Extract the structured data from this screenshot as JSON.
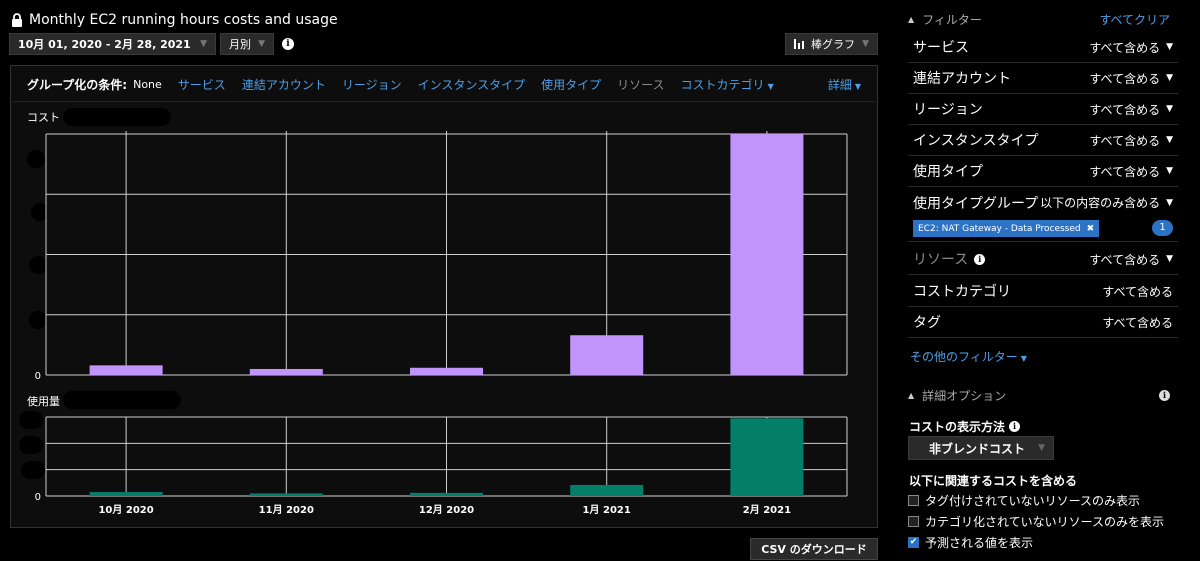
{
  "header": {
    "title": "Monthly EC2 running hours costs and usage",
    "date_range": "10月 01, 2020 - 2月 28, 2021",
    "granularity": "月別",
    "chart_type": "棒グラフ"
  },
  "group_by": {
    "label": "グループ化の条件:",
    "value": "None",
    "links": [
      "サービス",
      "連結アカウント",
      "リージョン",
      "インスタンスタイプ",
      "使用タイプ",
      "リソース",
      "コストカテゴリ"
    ],
    "detail": "詳細"
  },
  "chart_data": [
    {
      "type": "bar",
      "ylabel": "コスト",
      "categories": [
        "10月 2020",
        "11月 2020",
        "12月 2020",
        "1月 2021",
        "2月 2021"
      ],
      "values": [
        4,
        2.5,
        3,
        16.5,
        111
      ],
      "ylim": [
        0,
        100
      ],
      "y_zero_label": "0",
      "color": "#c194fb",
      "grid": true
    },
    {
      "type": "bar",
      "ylabel": "使用量",
      "categories": [
        "10月 2020",
        "11月 2020",
        "12月 2020",
        "1月 2021",
        "2月 2021"
      ],
      "values": [
        1.5,
        1,
        1.2,
        4.2,
        29.5
      ],
      "ylim": [
        0,
        30
      ],
      "y_zero_label": "0",
      "color": "#037f68",
      "grid": true
    }
  ],
  "csv_button": "CSV のダウンロード",
  "filters": {
    "title": "フィルター",
    "clear": "すべてクリア",
    "rows": [
      {
        "name": "サービス",
        "value": "すべて含める"
      },
      {
        "name": "連結アカウント",
        "value": "すべて含める"
      },
      {
        "name": "リージョン",
        "value": "すべて含める"
      },
      {
        "name": "インスタンスタイプ",
        "value": "すべて含める"
      },
      {
        "name": "使用タイプ",
        "value": "すべて含める"
      },
      {
        "name": "使用タイプグループ",
        "value": "以下の内容のみ含める"
      },
      {
        "name": "リソース",
        "value": "すべて含める"
      },
      {
        "name": "コストカテゴリ",
        "value": "すべて含める"
      },
      {
        "name": "タグ",
        "value": "すべて含める"
      }
    ],
    "tag_chip": "EC2: NAT Gateway - Data Processed",
    "tag_count": "1",
    "more": "その他のフィルター"
  },
  "advanced": {
    "title": "詳細オプション",
    "cost_display_label": "コストの表示方法",
    "cost_display_value": "非ブレンドコスト",
    "include_label": "以下に関連するコストを含める",
    "options": [
      {
        "label": "タグ付けされていないリソースのみ表示",
        "checked": false
      },
      {
        "label": "カテゴリ化されていないリソースのみを表示",
        "checked": false
      },
      {
        "label": "予測される値を表示",
        "checked": true
      }
    ]
  }
}
